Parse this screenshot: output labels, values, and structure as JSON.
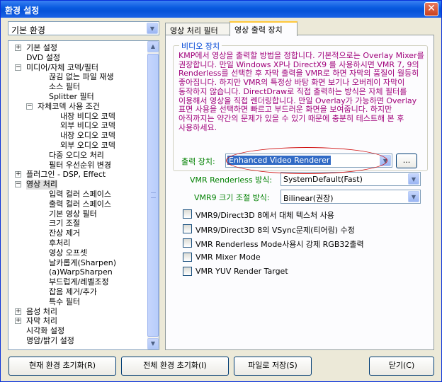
{
  "window": {
    "title": "환경 설정",
    "close_glyph": "✕"
  },
  "env_select": {
    "value": "기본 환경"
  },
  "tree": [
    {
      "label": "기본 설정",
      "expander": "+"
    },
    {
      "label": "DVD 설정",
      "expander": ""
    },
    {
      "label": "미디어/자체 코덱/필터",
      "expander": "−"
    },
    {
      "label": "끊김 없는 파일 재생",
      "expander": ""
    },
    {
      "label": "소스 필터",
      "expander": ""
    },
    {
      "label": "Splitter 필터",
      "expander": ""
    },
    {
      "label": "자체코덱 사용 조건",
      "expander": "−"
    },
    {
      "label": "내장 비디오 코덱",
      "expander": ""
    },
    {
      "label": "외부 비디오 코덱",
      "expander": ""
    },
    {
      "label": "내장 오디오 코덱",
      "expander": ""
    },
    {
      "label": "외부 오디오 코덱",
      "expander": ""
    },
    {
      "label": "다중 오디오 처리",
      "expander": ""
    },
    {
      "label": "필터 우선순위 변경",
      "expander": ""
    },
    {
      "label": "플러그인 - DSP, Effect",
      "expander": "+"
    },
    {
      "label": "영상 처리",
      "expander": "−"
    },
    {
      "label": "입력 컬러 스페이스",
      "expander": ""
    },
    {
      "label": "출력 컬러 스페이스",
      "expander": ""
    },
    {
      "label": "기본 영상 필터",
      "expander": ""
    },
    {
      "label": "크기 조절",
      "expander": ""
    },
    {
      "label": "잔상 제거",
      "expander": ""
    },
    {
      "label": "후처리",
      "expander": ""
    },
    {
      "label": "영상 오프셋",
      "expander": ""
    },
    {
      "label": "날카롭게(Sharpen)",
      "expander": ""
    },
    {
      "label": "(a)WarpSharpen",
      "expander": ""
    },
    {
      "label": "부드럽게/레벨조정",
      "expander": ""
    },
    {
      "label": "잡음 제거/추가",
      "expander": ""
    },
    {
      "label": "특수 필터",
      "expander": ""
    },
    {
      "label": "음성 처리",
      "expander": "+"
    },
    {
      "label": "자막 처리",
      "expander": "+"
    },
    {
      "label": "시각화 설정",
      "expander": ""
    },
    {
      "label": "명암/밝기 설정",
      "expander": ""
    }
  ],
  "tabs": [
    {
      "label": "영상 처리 필터"
    },
    {
      "label": "영상 출력 장치"
    }
  ],
  "video_device": {
    "group_title": "비디오 장치",
    "description": "KMP에서 영상을 출력할 방법을 정합니다. 기본적으로는 Overlay Mixer를 권장합니다. 만일 Windows XP나 DirectX9 를 사용하시면 VMR 7, 9의 Renderless를 선택한 후 자막 출력을 VMR로 하면 자막의 품질이 월등히 좋아집니다. 하지만 VMR의 특정상 바탕 화면 보기나 오버레이 자막이 동작하지 않습니다. DirectDraw로 직접 출력하는 방식은 자체 필터를 이용해서 영상을 직접 렌더링합니다. 만일 Overlay가 가능하면 Overlay 표면 사용을 선택하면 빠르고 부드러운 화면을 보여줍니다. 하지만 아직까지는 약간의 문제가 있을 수 있기 때문에 충분히 테스트해 본 후 사용하세요.",
    "output_label": "출력 장치:",
    "output_value": "Enhanced Video Renderer",
    "more_button": "...",
    "renderless_label": "VMR Renderless 방식:",
    "renderless_value": "SystemDefault(Fast)",
    "resize_label": "VMR9 크기 조절 방식:",
    "resize_value": "Bilinear(권장)"
  },
  "checkboxes": [
    {
      "label": "VMR9/Direct3D 8에서 대체 텍스처 사용"
    },
    {
      "label": "VMR9/Direct3D 8의 VSync문제(티어링) 수정"
    },
    {
      "label": "VMR Renderless Mode사용시 강제 RGB32출력"
    },
    {
      "label": "VMR Mixer Mode"
    },
    {
      "label": "VMR YUV Render Target"
    }
  ],
  "buttons": {
    "reset_current": "현재 환경 초기화(R)",
    "reset_all": "전체 환경 초기화(I)",
    "save_file": "파일로 저장(S)",
    "close": "닫기(C)"
  },
  "icons": {
    "dropdown": "chevron-down-icon",
    "close": "close-icon",
    "scroll_up": "scroll-up-arrow-icon",
    "scroll_down": "scroll-down-arrow-icon"
  }
}
